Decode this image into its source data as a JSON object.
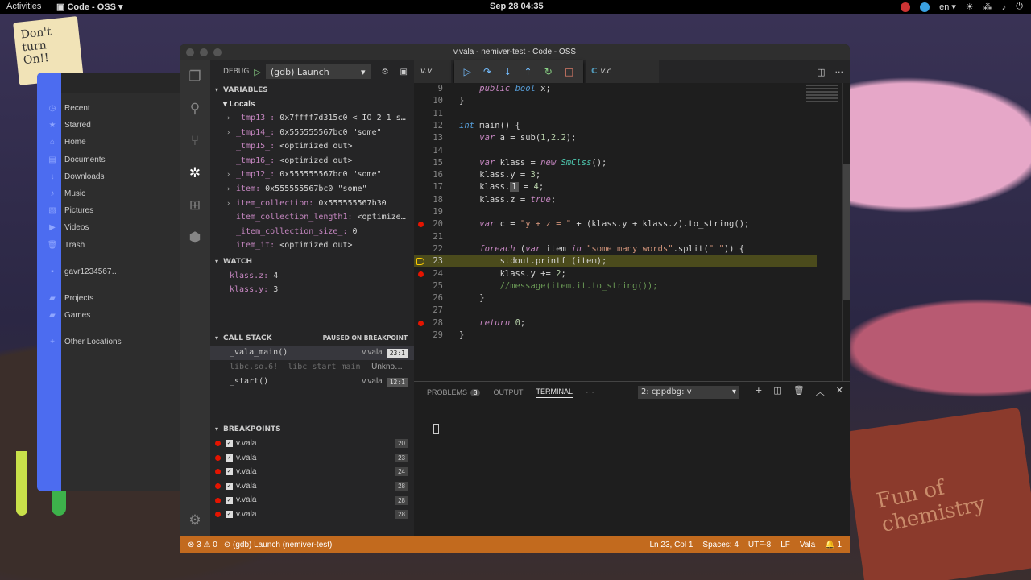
{
  "topbar": {
    "activities": "Activities",
    "app": "Code - OSS",
    "clock": "Sep 28  04:35",
    "lang": "en"
  },
  "files": {
    "items": [
      {
        "icon": "◷",
        "label": "Recent"
      },
      {
        "icon": "★",
        "label": "Starred"
      },
      {
        "icon": "⌂",
        "label": "Home"
      },
      {
        "icon": "▤",
        "label": "Documents"
      },
      {
        "icon": "↓",
        "label": "Downloads"
      },
      {
        "icon": "♪",
        "label": "Music"
      },
      {
        "icon": "▧",
        "label": "Pictures"
      },
      {
        "icon": "▶",
        "label": "Videos"
      },
      {
        "icon": "🗑",
        "label": "Trash"
      },
      {
        "icon": "",
        "label": ""
      },
      {
        "icon": "▪",
        "label": "gavr1234567…"
      },
      {
        "icon": "",
        "label": ""
      },
      {
        "icon": "▰",
        "label": "Projects"
      },
      {
        "icon": "▰",
        "label": "Games"
      },
      {
        "icon": "",
        "label": ""
      },
      {
        "icon": "+",
        "label": "Other Locations"
      }
    ]
  },
  "window": {
    "title": "v.vala - nemiver-test - Code - OSS"
  },
  "debug": {
    "label": "DEBUG",
    "config": "(gdb) Launch",
    "variables_title": "VARIABLES",
    "locals_title": "Locals",
    "variables": [
      {
        "exp": "›",
        "name": "_tmp13_:",
        "value": " 0x7ffff7d315c0 <_IO_2_1_s…"
      },
      {
        "exp": "›",
        "name": "_tmp14_:",
        "value": " 0x555555567bc0 \"some\""
      },
      {
        "exp": "",
        "name": "_tmp15_:",
        "value": " <optimized out>"
      },
      {
        "exp": "",
        "name": "_tmp16_:",
        "value": " <optimized out>"
      },
      {
        "exp": "›",
        "name": "_tmp12_:",
        "value": " 0x555555567bc0 \"some\""
      },
      {
        "exp": "›",
        "name": "item:",
        "value": " 0x555555567bc0 \"some\""
      },
      {
        "exp": "›",
        "name": "item_collection:",
        "value": " 0x555555567b30"
      },
      {
        "exp": "",
        "name": "item_collection_length1:",
        "value": " <optimize…"
      },
      {
        "exp": "",
        "name": "_item_collection_size_:",
        "value": " 0"
      },
      {
        "exp": "",
        "name": "item_it:",
        "value": " <optimized out>"
      }
    ],
    "watch_title": "WATCH",
    "watch": [
      {
        "name": "klass.z:",
        "value": " 4"
      },
      {
        "name": "klass.y:",
        "value": " 3"
      }
    ],
    "callstack_title": "CALL STACK",
    "callstack_status": "PAUSED ON BREAKPOINT",
    "callstack": [
      {
        "fn": "_vala_main()",
        "file": "v.vala",
        "line": "23:1"
      },
      {
        "fn": "libc.so.6!__libc_start_main",
        "file": "Unkno…",
        "line": ""
      },
      {
        "fn": "_start()",
        "file": "v.vala",
        "line": "12:1"
      }
    ],
    "breakpoints_title": "BREAKPOINTS",
    "breakpoints": [
      {
        "file": "v.vala",
        "line": "20"
      },
      {
        "file": "v.vala",
        "line": "23"
      },
      {
        "file": "v.vala",
        "line": "24"
      },
      {
        "file": "v.vala",
        "line": "28"
      },
      {
        "file": "v.vala",
        "line": "28"
      },
      {
        "file": "v.vala",
        "line": "28"
      }
    ]
  },
  "tabs": {
    "tab1": "v.v",
    "tab2_icon": "C",
    "tab2": "v.c"
  },
  "editor": {
    "hover_value": "1",
    "line_numbers": [
      "9",
      "10",
      "11",
      "12",
      "13",
      "14",
      "15",
      "16",
      "17",
      "18",
      "19",
      "20",
      "21",
      "22",
      "23",
      "24",
      "25",
      "26",
      "27",
      "28",
      "29"
    ]
  },
  "panel": {
    "problems": "PROBLEMS",
    "problems_count": "3",
    "output": "OUTPUT",
    "terminal": "TERMINAL",
    "more": "···",
    "terminal_select": "2: cppdbg: v"
  },
  "status": {
    "errors": "3",
    "warnings": "0",
    "launch": "(gdb) Launch (nemiver-test)",
    "position": "Ln 23, Col 1",
    "spaces": "Spaces: 4",
    "encoding": "UTF-8",
    "eol": "LF",
    "language": "Vala",
    "notifications": "1"
  },
  "wallpaper": {
    "note": "Don't turn On!!",
    "book": "Fun of chemistry"
  }
}
